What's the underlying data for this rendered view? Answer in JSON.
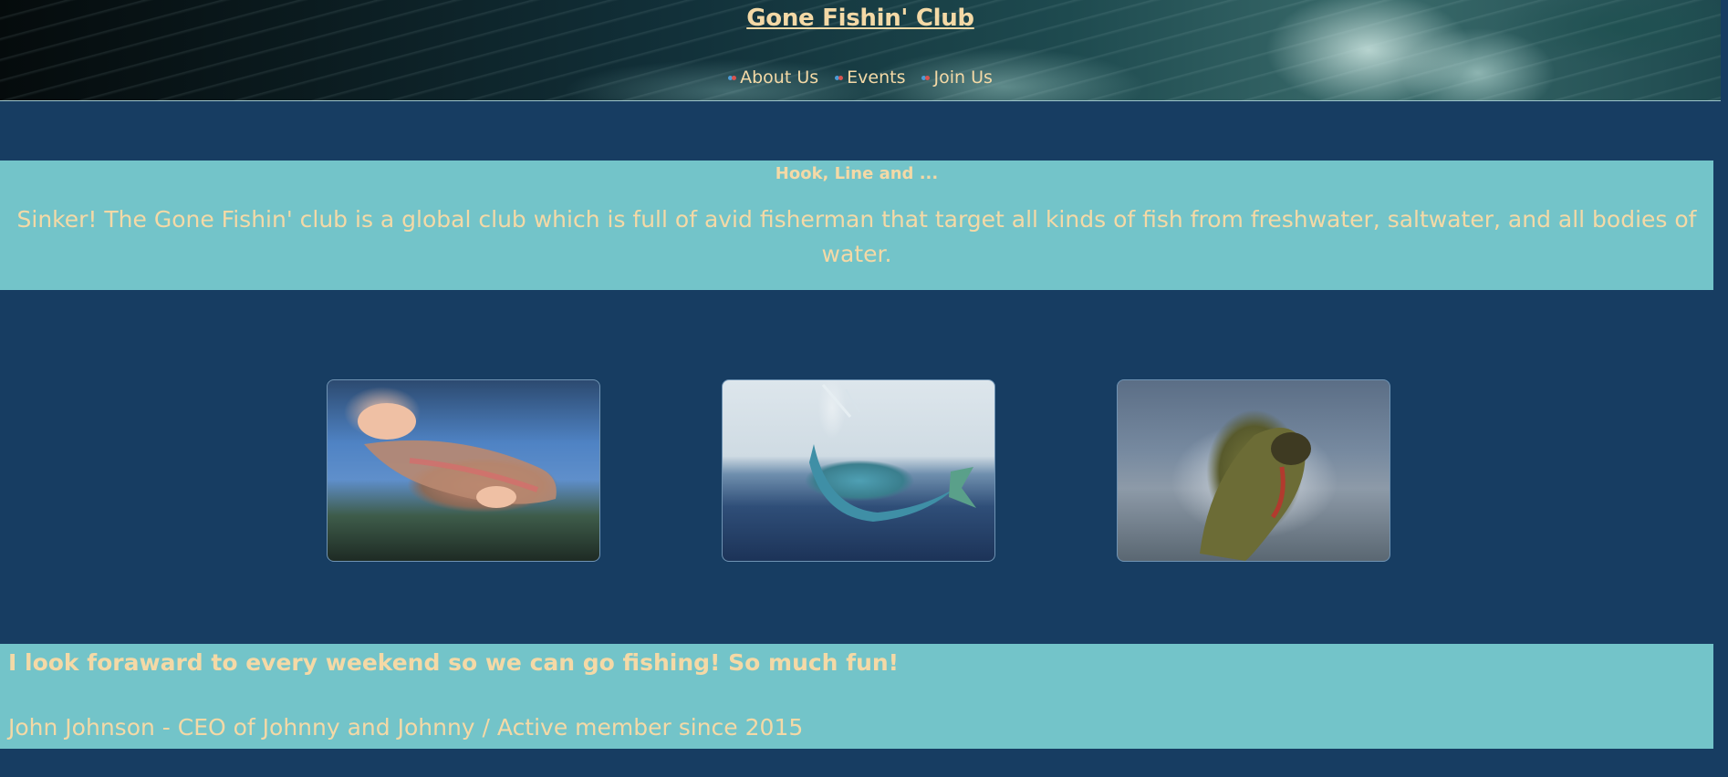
{
  "header": {
    "title": "Gone Fishin' Club",
    "nav": [
      {
        "label": "About Us",
        "icon": "bullet-icon"
      },
      {
        "label": "Events",
        "icon": "bullet-icon"
      },
      {
        "label": "Join Us",
        "icon": "bullet-icon"
      }
    ]
  },
  "intro": {
    "heading": "Hook, Line and ...",
    "text": "Sinker! The Gone Fishin' club is a global club which is full of avid fisherman that target all kinds of fish from freshwater, saltwater, and all bodies of water."
  },
  "gallery": [
    {
      "subject": "rainbow-trout-photo"
    },
    {
      "subject": "mahi-mahi-photo"
    },
    {
      "subject": "largemouth-bass-photo"
    }
  ],
  "testimonial": {
    "quote": "I look foraward to every weekend so we can go fishing! So much fun!",
    "attribution": "John Johnson - CEO of Johnny and Johnny / Active member since 2015"
  },
  "colors": {
    "page_background": "#173d62",
    "band_background": "#73c4c9",
    "text": "#f4d9a6"
  }
}
